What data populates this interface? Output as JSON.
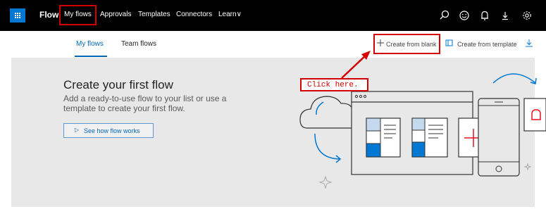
{
  "topbar": {
    "app_name": "Flow",
    "nav": [
      "My flows",
      "Approvals",
      "Templates",
      "Connectors",
      "Learn∨"
    ],
    "icons": [
      "search-icon",
      "smiley-icon",
      "bell-icon",
      "download-icon",
      "gear-icon"
    ]
  },
  "subnav": {
    "tabs": [
      "My flows",
      "Team flows"
    ],
    "create_blank": "Create from blank",
    "create_template": "Create from template"
  },
  "hero": {
    "title": "Create your first flow",
    "subtitle": "Add a ready-to-use flow to your list or use a template to create your first flow.",
    "button": "See how flow works"
  },
  "annotation": {
    "callout": "Click here."
  },
  "colors": {
    "highlight": "#d40000",
    "accent": "#0078d4",
    "topbar": "#000000",
    "hero_bg": "#e8e8e8"
  }
}
